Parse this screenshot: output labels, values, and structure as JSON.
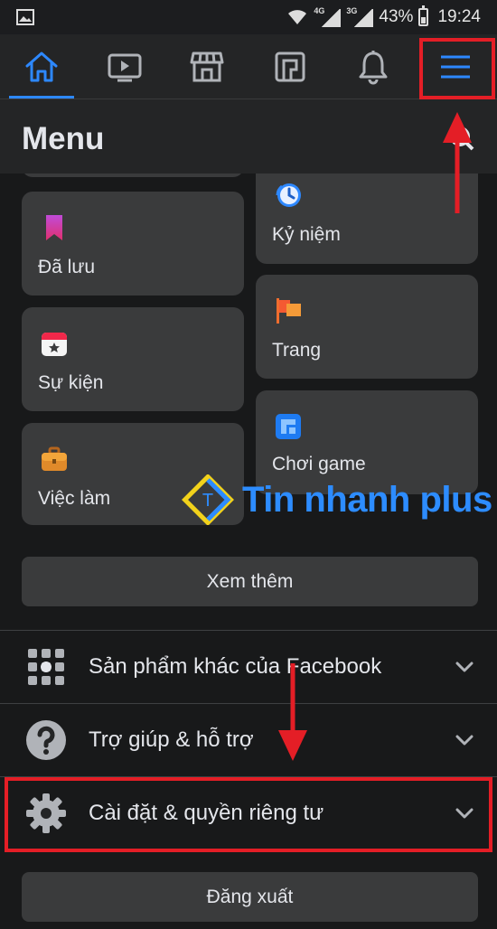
{
  "status_bar": {
    "image_icon": "image-icon",
    "wifi_icon": "wifi-icon",
    "network1": "4G",
    "network2": "3G",
    "battery_percent": "43%",
    "battery_level": 0.43,
    "time": "19:24"
  },
  "tabs": [
    {
      "name": "home",
      "icon": "home-icon",
      "active": true
    },
    {
      "name": "watch",
      "icon": "video-icon",
      "active": false
    },
    {
      "name": "marketplace",
      "icon": "store-icon",
      "active": false
    },
    {
      "name": "news",
      "icon": "feed-icon",
      "active": false
    },
    {
      "name": "notifications",
      "icon": "bell-icon",
      "active": false
    },
    {
      "name": "menu",
      "icon": "hamburger-icon",
      "active": false
    }
  ],
  "header": {
    "title": "Menu",
    "search_icon": "search-icon"
  },
  "shortcuts": {
    "saved": "Đã lưu",
    "events": "Sự kiện",
    "jobs": "Việc làm",
    "memories": "Kỷ niệm",
    "pages": "Trang",
    "gaming": "Chơi game"
  },
  "see_more": "Xem thêm",
  "sections": [
    {
      "label": "Sản phẩm khác của Facebook",
      "icon": "grid-icon"
    },
    {
      "label": "Trợ giúp & hỗ trợ",
      "icon": "question-icon"
    },
    {
      "label": "Cài đặt & quyền riêng tư",
      "icon": "gear-icon"
    }
  ],
  "logout": "Đăng xuất",
  "watermark": {
    "text": "Tin nhanh plus",
    "badge": "T"
  },
  "colors": {
    "accent": "#2d88ff",
    "highlight": "#e41e26",
    "bg": "#18191a",
    "card": "#3a3b3c"
  }
}
